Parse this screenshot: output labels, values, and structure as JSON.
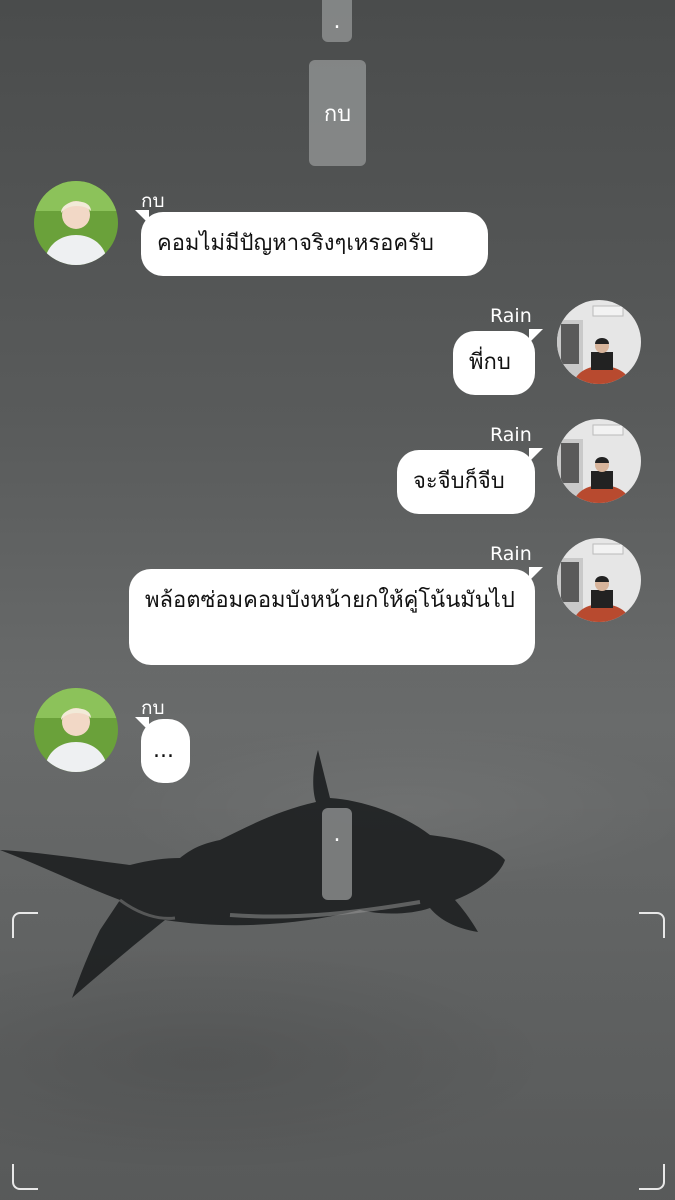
{
  "top_pill": {
    "text": "."
  },
  "header_pill": {
    "text": "กบ"
  },
  "messages": [
    {
      "sender": "กบ",
      "text": "คอมไม่มีปัญหาจริงๆเหรอครับ"
    },
    {
      "sender": "Rain",
      "text": "พี่กบ"
    },
    {
      "sender": "Rain",
      "text": "จะจีบก็จีบ"
    },
    {
      "sender": "Rain",
      "text": "พล้อตซ่อมคอมบังหน้ายกให้คู่โน้นมันไป"
    },
    {
      "sender": "กบ",
      "text": "..."
    }
  ],
  "bottom_pill": {
    "text": "."
  },
  "colors": {
    "bubble": "#ffffff",
    "pill": "#969898",
    "text": "#111111"
  }
}
